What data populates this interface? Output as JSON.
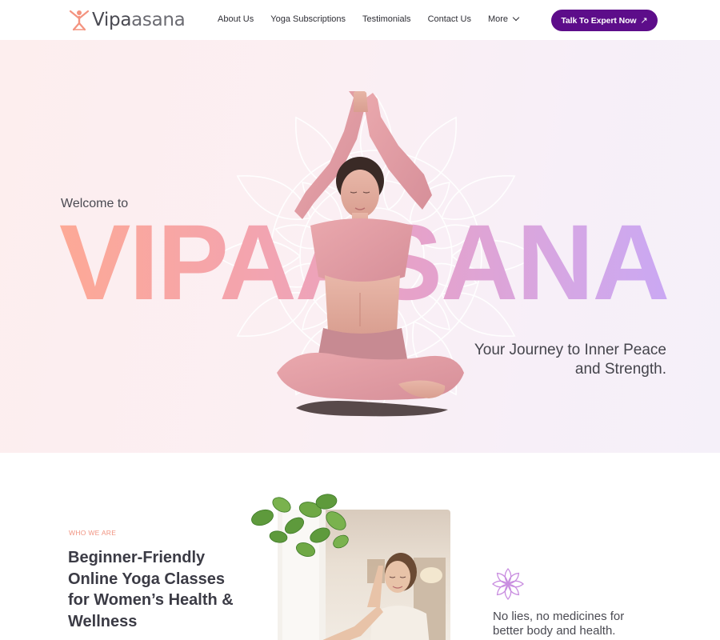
{
  "header": {
    "logo": {
      "text_a": "Vipa",
      "text_b": "asana",
      "icon": "yoga-figure-icon"
    },
    "nav": [
      {
        "label": "About Us"
      },
      {
        "label": "Yoga Subscriptions"
      },
      {
        "label": "Testimonials"
      },
      {
        "label": "Contact Us"
      },
      {
        "label": "More",
        "icon": "chevron-down-icon"
      }
    ],
    "cta": {
      "label": "Talk To Expert Now",
      "arrow": "↗"
    }
  },
  "hero": {
    "welcome": "Welcome to",
    "title": "VIPAASANA",
    "tagline_line1": "Your Journey to Inner Peace",
    "tagline_line2": "and Strength."
  },
  "about": {
    "eyebrow": "WHO WE ARE",
    "title_lines": [
      "Beginner-Friendly",
      "Online Yoga Classes",
      "for Women’s Health &",
      "Wellness"
    ],
    "benefit_lines": [
      "No lies, no medicines for",
      "better body and health."
    ]
  },
  "colors": {
    "brand_purple": "#5d0d8a",
    "accent_coral": "#f19482",
    "title_gradient_start": "#fda996",
    "title_gradient_end": "#caa8f3"
  }
}
